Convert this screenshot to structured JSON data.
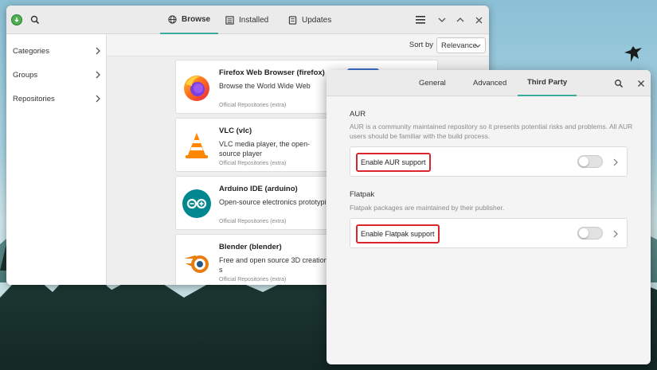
{
  "main_window": {
    "tabs": [
      {
        "label": "Browse",
        "icon": "globe-icon"
      },
      {
        "label": "Installed",
        "icon": "installed-list-icon"
      },
      {
        "label": "Updates",
        "icon": "updates-icon"
      }
    ],
    "sidebar": [
      {
        "label": "Categories"
      },
      {
        "label": "Groups"
      },
      {
        "label": "Repositories"
      }
    ],
    "sort": {
      "label": "Sort by",
      "value": "Relevance"
    },
    "apps": [
      {
        "title": "Firefox Web Browser (firefox)",
        "description": "Browse the World Wide Web",
        "repo": "Official Repositories (extra)"
      },
      {
        "title": "VLC (vlc)",
        "description": "VLC media player, the open-source player",
        "repo": "Official Repositories (extra)"
      },
      {
        "title": "Arduino IDE (arduino)",
        "description": "Open-source electronics prototypi",
        "repo": "Official Repositories (extra)"
      },
      {
        "title": "Blender (blender)",
        "description": "Free and open source 3D creation s",
        "repo": "Official Repositories (extra)"
      }
    ]
  },
  "dialog": {
    "tabs": [
      {
        "label": "General"
      },
      {
        "label": "Advanced"
      },
      {
        "label": "Third Party"
      }
    ],
    "aur": {
      "title": "AUR",
      "description": "AUR is a community maintained repository so it presents potential risks and problems. All AUR users should be familiar with the build process.",
      "setting_label": "Enable AUR support",
      "enabled": false
    },
    "flatpak": {
      "title": "Flatpak",
      "description": "Flatpak packages are maintained by their publisher.",
      "setting_label": "Enable Flatpak support",
      "enabled": false
    }
  },
  "colors": {
    "accent": "#3da89e",
    "highlight_border": "#d9262c",
    "install_button": "#3b6fc9"
  }
}
